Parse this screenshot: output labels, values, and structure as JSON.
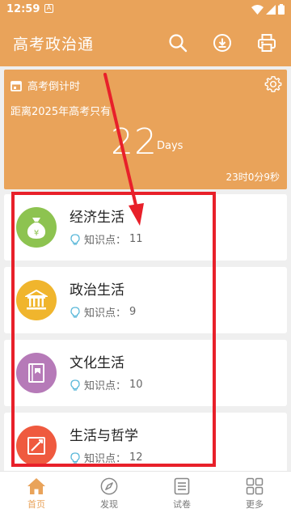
{
  "status_bar": {
    "time": "12:59",
    "a_badge": "A"
  },
  "app_bar": {
    "title": "高考政治通"
  },
  "countdown": {
    "header": "高考倒计时",
    "subtitle": "距离2025年高考只有",
    "days_number": "22",
    "days_unit": "Days",
    "time_left": "23时0分9秒"
  },
  "cards": [
    {
      "title": "经济生活",
      "meta_label": "知识点：",
      "meta_count": "11",
      "color": "#8dc350"
    },
    {
      "title": "政治生活",
      "meta_label": "知识点：",
      "meta_count": "9",
      "color": "#f0b52d"
    },
    {
      "title": "文化生活",
      "meta_label": "知识点：",
      "meta_count": "10",
      "color": "#b67ab8"
    },
    {
      "title": "生活与哲学",
      "meta_label": "知识点：",
      "meta_count": "12",
      "color": "#ef5a3f"
    }
  ],
  "bottom_nav": {
    "items": [
      {
        "label": "首页",
        "icon": "home-icon",
        "active": true
      },
      {
        "label": "发现",
        "icon": "compass-icon",
        "active": false
      },
      {
        "label": "试卷",
        "icon": "paper-icon",
        "active": false
      },
      {
        "label": "更多",
        "icon": "grid-icon",
        "active": false
      }
    ]
  },
  "colors": {
    "accent": "#e9a35a",
    "annotation": "#e8202a"
  }
}
